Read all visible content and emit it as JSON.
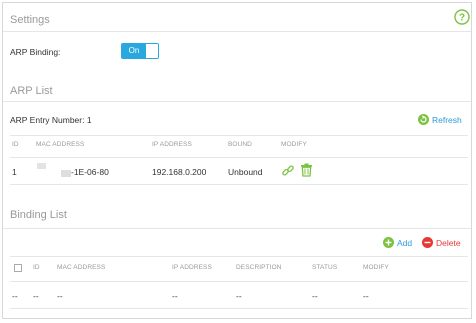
{
  "header": {
    "title": "Settings",
    "help_icon": "question-circle-icon",
    "help_glyph": "?"
  },
  "arp_binding": {
    "label": "ARP Binding:",
    "toggle_on": "On"
  },
  "arp_list": {
    "title": "ARP List",
    "entry_number_label": "ARP Entry Number: 1",
    "refresh_label": "Refresh",
    "columns": [
      "ID",
      "MAC ADDRESS",
      "IP ADDRESS",
      "BOUND",
      "MODIFY"
    ],
    "rows": [
      {
        "id": "1",
        "mac": "-1E-06-80",
        "ip": "192.168.0.200",
        "bound": "Unbound"
      }
    ]
  },
  "binding_list": {
    "title": "Binding List",
    "add_label": "Add",
    "delete_label": "Delete",
    "columns": [
      "ID",
      "MAC ADDRESS",
      "IP ADDRESS",
      "DESCRIPTION",
      "STATUS",
      "MODIFY"
    ],
    "empty_row": [
      "--",
      "--",
      "--",
      "--",
      "--",
      "--",
      "--"
    ]
  },
  "colors": {
    "accent_green": "#7cc242",
    "accent_blue": "#29a8e0",
    "delete_red": "#e53935"
  }
}
